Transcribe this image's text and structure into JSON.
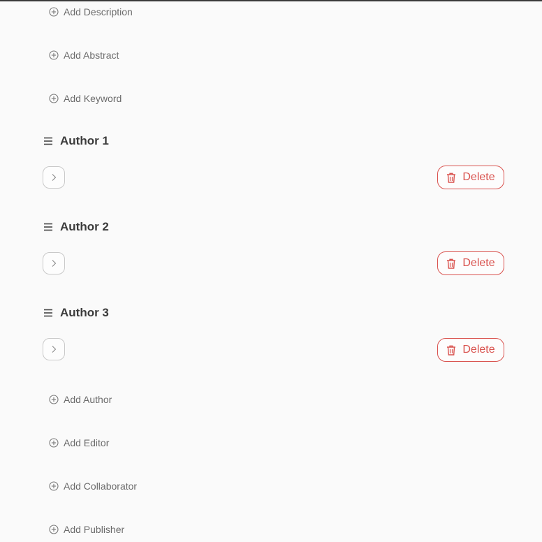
{
  "links_top": [
    {
      "label": "Add Description"
    },
    {
      "label": "Add Abstract"
    },
    {
      "label": "Add Keyword"
    }
  ],
  "authors": [
    {
      "title": "Author 1",
      "delete_label": "Delete"
    },
    {
      "title": "Author 2",
      "delete_label": "Delete"
    },
    {
      "title": "Author 3",
      "delete_label": "Delete"
    }
  ],
  "links_bottom": [
    {
      "label": "Add Author"
    },
    {
      "label": "Add Editor"
    },
    {
      "label": "Add Collaborator"
    },
    {
      "label": "Add Publisher"
    }
  ],
  "icons": {
    "add": "plus-circle-icon",
    "drag": "hamburger-drag-icon",
    "expand": "chevron-right-icon",
    "delete": "trash-icon"
  },
  "colors": {
    "background": "#fafafa",
    "danger": "#d9534f",
    "link_text": "#6b6b6b",
    "heading_text": "#3b3b3b"
  }
}
